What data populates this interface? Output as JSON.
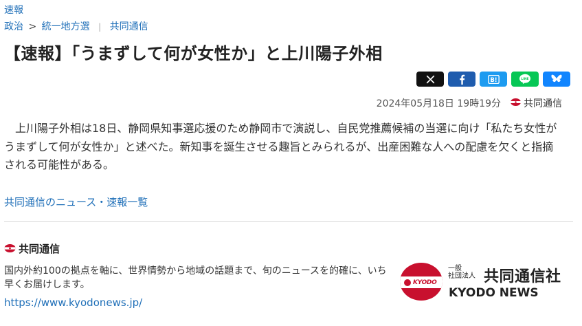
{
  "breadcrumb": {
    "top": "速報",
    "items": [
      "政治",
      "統一地方選",
      "共同通信"
    ],
    "separator": ">",
    "divider": "|"
  },
  "article": {
    "title": "【速報】「うまずして何が女性か」と上川陽子外相",
    "date": "2024年05月18日 19時19分",
    "source": "共同通信",
    "lead": "上川陽子外相は18日、静岡県知事選応援のため静岡市で演説し、自民党推薦候補の当選に向け「私たち女性がうまずして何が女性か」と述べた。新知事を誕生させる趣旨とみられるが、出産困難な人への配慮を欠くと指摘される可能性がある。"
  },
  "share": {
    "buttons": [
      {
        "name": "x",
        "icon": "x-icon",
        "color": "#111111"
      },
      {
        "name": "facebook",
        "icon": "facebook-icon",
        "color": "#1f5cae"
      },
      {
        "name": "hatena",
        "icon": "hatena-bookmark-icon",
        "color": "#1d9bf0"
      },
      {
        "name": "line",
        "icon": "line-icon",
        "color": "#06c755"
      },
      {
        "name": "bluesky",
        "icon": "bluesky-icon",
        "color": "#1185fe"
      }
    ]
  },
  "links": {
    "news_list": "共同通信のニュース・速報一覧"
  },
  "publisher": {
    "name": "共同通信",
    "description": "国内外約100の拠点を軸に、世界情勢から地域の話題まで、旬のニュースを的確に、いち早くお届けします。",
    "url": "https://www.kyodonews.jp/",
    "logo": {
      "small_1": "一般",
      "small_2": "社団法人",
      "name_ja": "共同通信社",
      "name_en": "KYODO NEWS",
      "band_text": "KYODO"
    }
  },
  "colors": {
    "link": "#1f6fb8",
    "brand_red": "#c8102e"
  }
}
